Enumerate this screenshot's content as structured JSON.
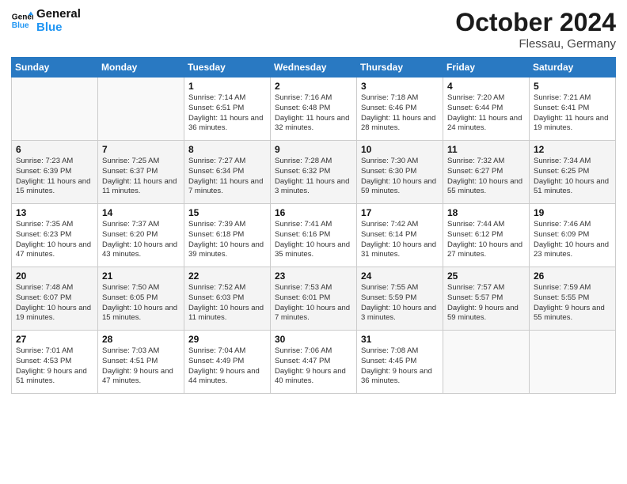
{
  "logo": {
    "line1": "General",
    "line2": "Blue"
  },
  "title": "October 2024",
  "location": "Flessau, Germany",
  "days_of_week": [
    "Sunday",
    "Monday",
    "Tuesday",
    "Wednesday",
    "Thursday",
    "Friday",
    "Saturday"
  ],
  "weeks": [
    [
      {
        "day": "",
        "sunrise": "",
        "sunset": "",
        "daylight": ""
      },
      {
        "day": "",
        "sunrise": "",
        "sunset": "",
        "daylight": ""
      },
      {
        "day": "1",
        "sunrise": "Sunrise: 7:14 AM",
        "sunset": "Sunset: 6:51 PM",
        "daylight": "Daylight: 11 hours and 36 minutes."
      },
      {
        "day": "2",
        "sunrise": "Sunrise: 7:16 AM",
        "sunset": "Sunset: 6:48 PM",
        "daylight": "Daylight: 11 hours and 32 minutes."
      },
      {
        "day": "3",
        "sunrise": "Sunrise: 7:18 AM",
        "sunset": "Sunset: 6:46 PM",
        "daylight": "Daylight: 11 hours and 28 minutes."
      },
      {
        "day": "4",
        "sunrise": "Sunrise: 7:20 AM",
        "sunset": "Sunset: 6:44 PM",
        "daylight": "Daylight: 11 hours and 24 minutes."
      },
      {
        "day": "5",
        "sunrise": "Sunrise: 7:21 AM",
        "sunset": "Sunset: 6:41 PM",
        "daylight": "Daylight: 11 hours and 19 minutes."
      }
    ],
    [
      {
        "day": "6",
        "sunrise": "Sunrise: 7:23 AM",
        "sunset": "Sunset: 6:39 PM",
        "daylight": "Daylight: 11 hours and 15 minutes."
      },
      {
        "day": "7",
        "sunrise": "Sunrise: 7:25 AM",
        "sunset": "Sunset: 6:37 PM",
        "daylight": "Daylight: 11 hours and 11 minutes."
      },
      {
        "day": "8",
        "sunrise": "Sunrise: 7:27 AM",
        "sunset": "Sunset: 6:34 PM",
        "daylight": "Daylight: 11 hours and 7 minutes."
      },
      {
        "day": "9",
        "sunrise": "Sunrise: 7:28 AM",
        "sunset": "Sunset: 6:32 PM",
        "daylight": "Daylight: 11 hours and 3 minutes."
      },
      {
        "day": "10",
        "sunrise": "Sunrise: 7:30 AM",
        "sunset": "Sunset: 6:30 PM",
        "daylight": "Daylight: 10 hours and 59 minutes."
      },
      {
        "day": "11",
        "sunrise": "Sunrise: 7:32 AM",
        "sunset": "Sunset: 6:27 PM",
        "daylight": "Daylight: 10 hours and 55 minutes."
      },
      {
        "day": "12",
        "sunrise": "Sunrise: 7:34 AM",
        "sunset": "Sunset: 6:25 PM",
        "daylight": "Daylight: 10 hours and 51 minutes."
      }
    ],
    [
      {
        "day": "13",
        "sunrise": "Sunrise: 7:35 AM",
        "sunset": "Sunset: 6:23 PM",
        "daylight": "Daylight: 10 hours and 47 minutes."
      },
      {
        "day": "14",
        "sunrise": "Sunrise: 7:37 AM",
        "sunset": "Sunset: 6:20 PM",
        "daylight": "Daylight: 10 hours and 43 minutes."
      },
      {
        "day": "15",
        "sunrise": "Sunrise: 7:39 AM",
        "sunset": "Sunset: 6:18 PM",
        "daylight": "Daylight: 10 hours and 39 minutes."
      },
      {
        "day": "16",
        "sunrise": "Sunrise: 7:41 AM",
        "sunset": "Sunset: 6:16 PM",
        "daylight": "Daylight: 10 hours and 35 minutes."
      },
      {
        "day": "17",
        "sunrise": "Sunrise: 7:42 AM",
        "sunset": "Sunset: 6:14 PM",
        "daylight": "Daylight: 10 hours and 31 minutes."
      },
      {
        "day": "18",
        "sunrise": "Sunrise: 7:44 AM",
        "sunset": "Sunset: 6:12 PM",
        "daylight": "Daylight: 10 hours and 27 minutes."
      },
      {
        "day": "19",
        "sunrise": "Sunrise: 7:46 AM",
        "sunset": "Sunset: 6:09 PM",
        "daylight": "Daylight: 10 hours and 23 minutes."
      }
    ],
    [
      {
        "day": "20",
        "sunrise": "Sunrise: 7:48 AM",
        "sunset": "Sunset: 6:07 PM",
        "daylight": "Daylight: 10 hours and 19 minutes."
      },
      {
        "day": "21",
        "sunrise": "Sunrise: 7:50 AM",
        "sunset": "Sunset: 6:05 PM",
        "daylight": "Daylight: 10 hours and 15 minutes."
      },
      {
        "day": "22",
        "sunrise": "Sunrise: 7:52 AM",
        "sunset": "Sunset: 6:03 PM",
        "daylight": "Daylight: 10 hours and 11 minutes."
      },
      {
        "day": "23",
        "sunrise": "Sunrise: 7:53 AM",
        "sunset": "Sunset: 6:01 PM",
        "daylight": "Daylight: 10 hours and 7 minutes."
      },
      {
        "day": "24",
        "sunrise": "Sunrise: 7:55 AM",
        "sunset": "Sunset: 5:59 PM",
        "daylight": "Daylight: 10 hours and 3 minutes."
      },
      {
        "day": "25",
        "sunrise": "Sunrise: 7:57 AM",
        "sunset": "Sunset: 5:57 PM",
        "daylight": "Daylight: 9 hours and 59 minutes."
      },
      {
        "day": "26",
        "sunrise": "Sunrise: 7:59 AM",
        "sunset": "Sunset: 5:55 PM",
        "daylight": "Daylight: 9 hours and 55 minutes."
      }
    ],
    [
      {
        "day": "27",
        "sunrise": "Sunrise: 7:01 AM",
        "sunset": "Sunset: 4:53 PM",
        "daylight": "Daylight: 9 hours and 51 minutes."
      },
      {
        "day": "28",
        "sunrise": "Sunrise: 7:03 AM",
        "sunset": "Sunset: 4:51 PM",
        "daylight": "Daylight: 9 hours and 47 minutes."
      },
      {
        "day": "29",
        "sunrise": "Sunrise: 7:04 AM",
        "sunset": "Sunset: 4:49 PM",
        "daylight": "Daylight: 9 hours and 44 minutes."
      },
      {
        "day": "30",
        "sunrise": "Sunrise: 7:06 AM",
        "sunset": "Sunset: 4:47 PM",
        "daylight": "Daylight: 9 hours and 40 minutes."
      },
      {
        "day": "31",
        "sunrise": "Sunrise: 7:08 AM",
        "sunset": "Sunset: 4:45 PM",
        "daylight": "Daylight: 9 hours and 36 minutes."
      },
      {
        "day": "",
        "sunrise": "",
        "sunset": "",
        "daylight": ""
      },
      {
        "day": "",
        "sunrise": "",
        "sunset": "",
        "daylight": ""
      }
    ]
  ]
}
